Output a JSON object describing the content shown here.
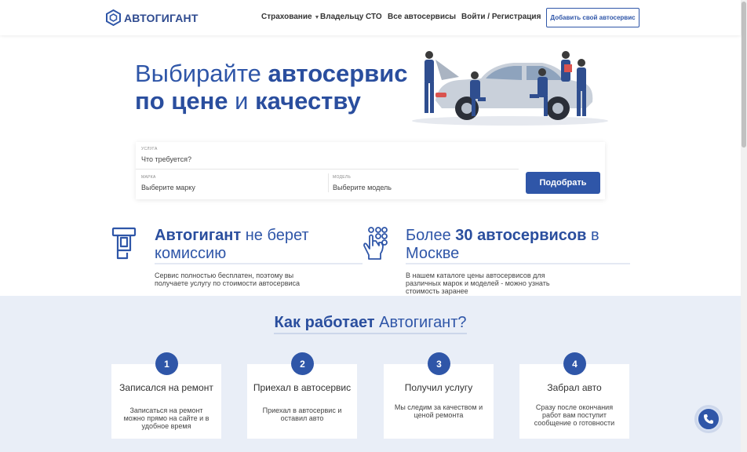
{
  "header": {
    "logo_text": "АВТОГИГАНТ",
    "nav": {
      "insurance": "Страхование",
      "owner": "Владельцу СТО",
      "all_services": "Все автосервисы",
      "login": "Войти / Регистрация"
    },
    "add_button": "Добавить свой автосервис"
  },
  "hero": {
    "title_l1_light": "Выбирайте",
    "title_l1_bold": "автосервис",
    "title_l2_bold_a": "по цене",
    "title_l2_light": "и",
    "title_l2_bold_b": "качеству"
  },
  "search": {
    "service_label": "Услуга",
    "service_value": "Что требуется?",
    "make_label": "Марка",
    "make_value": "Выберите марку",
    "model_label": "Модель",
    "model_value": "Выберите модель",
    "submit": "Подобрать"
  },
  "features": [
    {
      "bold": "Автогигант",
      "light": "не берет комиссию",
      "desc": "Сервис полностью бесплатен, поэтому вы получаете услугу по стоимости автосервиса"
    },
    {
      "light_a": "Более",
      "bold": "30 автосервисов",
      "light_b": "в Москве",
      "desc": "В нашем каталоге цены автосервисов для различных марок и моделей - можно узнать стоимость заранее"
    }
  ],
  "how": {
    "title_bold": "Как работает",
    "title_light": "Автогигант?",
    "steps": [
      {
        "num": "1",
        "title": "Записался на ремонт",
        "desc": "Записаться на ремонт можно прямо на сайте и в удобное время"
      },
      {
        "num": "2",
        "title": "Приехал в автосервис",
        "desc": "Приехал в автосервис и оставил авто"
      },
      {
        "num": "3",
        "title": "Получил услугу",
        "desc": "Мы следим за качеством и ценой ремонта"
      },
      {
        "num": "4",
        "title": "Забрал авто",
        "desc": "Сразу после окончания работ вам поступит сообщение о готовности"
      }
    ]
  },
  "colors": {
    "brand": "#2f56a8",
    "section_bg": "#e9eef7"
  }
}
